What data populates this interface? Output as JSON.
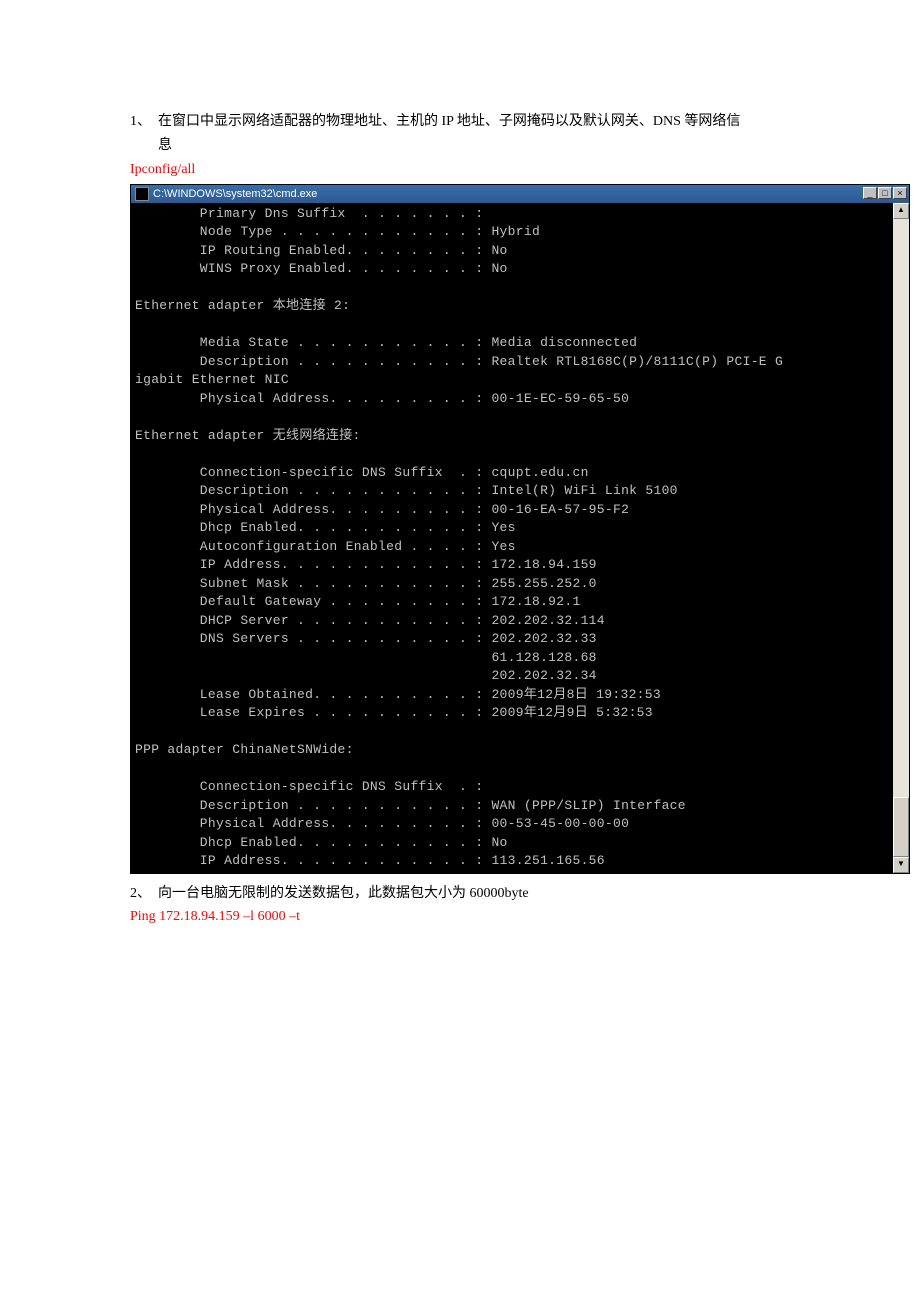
{
  "q1": {
    "num": "1、",
    "text_line1": "在窗口中显示网络适配器的物理地址、主机的 IP 地址、子网掩码以及默认网关、DNS 等网络信",
    "text_line2": "息",
    "answer": "Ipconfig/all"
  },
  "window": {
    "title": "C:\\WINDOWS\\system32\\cmd.exe",
    "btn_min": "_",
    "btn_max": "□",
    "btn_close": "×",
    "sb_up": "▲",
    "sb_down": "▼"
  },
  "terminal": {
    "lines": [
      "        Primary Dns Suffix  . . . . . . . :",
      "        Node Type . . . . . . . . . . . . : Hybrid",
      "        IP Routing Enabled. . . . . . . . : No",
      "        WINS Proxy Enabled. . . . . . . . : No",
      "",
      "Ethernet adapter 本地连接 2:",
      "",
      "        Media State . . . . . . . . . . . : Media disconnected",
      "        Description . . . . . . . . . . . : Realtek RTL8168C(P)/8111C(P) PCI-E G",
      "igabit Ethernet NIC",
      "        Physical Address. . . . . . . . . : 00-1E-EC-59-65-50",
      "",
      "Ethernet adapter 无线网络连接:",
      "",
      "        Connection-specific DNS Suffix  . : cqupt.edu.cn",
      "        Description . . . . . . . . . . . : Intel(R) WiFi Link 5100",
      "        Physical Address. . . . . . . . . : 00-16-EA-57-95-F2",
      "        Dhcp Enabled. . . . . . . . . . . : Yes",
      "        Autoconfiguration Enabled . . . . : Yes",
      "        IP Address. . . . . . . . . . . . : 172.18.94.159",
      "        Subnet Mask . . . . . . . . . . . : 255.255.252.0",
      "        Default Gateway . . . . . . . . . : 172.18.92.1",
      "        DHCP Server . . . . . . . . . . . : 202.202.32.114",
      "        DNS Servers . . . . . . . . . . . : 202.202.32.33",
      "                                            61.128.128.68",
      "                                            202.202.32.34",
      "        Lease Obtained. . . . . . . . . . : 2009年12月8日 19:32:53",
      "        Lease Expires . . . . . . . . . . : 2009年12月9日 5:32:53",
      "",
      "PPP adapter ChinaNetSNWide:",
      "",
      "        Connection-specific DNS Suffix  . :",
      "        Description . . . . . . . . . . . : WAN (PPP/SLIP) Interface",
      "        Physical Address. . . . . . . . . : 00-53-45-00-00-00",
      "        Dhcp Enabled. . . . . . . . . . . : No",
      "        IP Address. . . . . . . . . . . . : 113.251.165.56"
    ]
  },
  "q2": {
    "num": "2、",
    "text": "向一台电脑无限制的发送数据包，此数据包大小为 60000byte",
    "answer": "Ping 172.18.94.159 –l 6000 –t"
  }
}
